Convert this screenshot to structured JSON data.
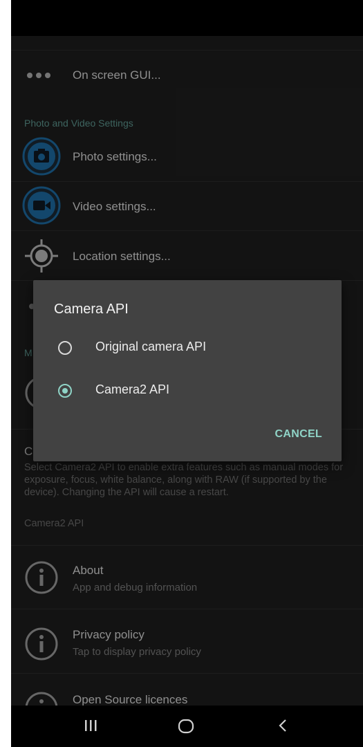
{
  "settings": {
    "on_screen_gui": "On screen GUI...",
    "photo_video_header": "Photo and Video Settings",
    "photo_settings": "Photo settings...",
    "video_settings": "Video settings...",
    "location_settings": "Location settings...",
    "camera_api_partial_title": "C",
    "misc_header_partial": "M",
    "camera_api_desc": "Select Camera2 API to enable extra features such as manual modes for exposure, focus, white balance, along with RAW (if supported by the device). Changing the API will cause a restart.",
    "camera_api_value": "Camera2 API",
    "about_title": "About",
    "about_sub": "App and debug information",
    "privacy_title": "Privacy policy",
    "privacy_sub": "Tap to display privacy policy",
    "licences_title": "Open Source licences"
  },
  "dialog": {
    "title": "Camera API",
    "options": [
      {
        "label": "Original camera API",
        "selected": false
      },
      {
        "label": "Camera2 API",
        "selected": true
      }
    ],
    "cancel_label": "CANCEL"
  },
  "colors": {
    "accent": "#8fd3c6",
    "section_header": "#5f9a93",
    "icon_blue": "#1e6ea7",
    "dialog_bg": "#424242",
    "list_bg": "#1e1e1e"
  },
  "icons": {
    "dots": "more-horiz-icon",
    "photo": "camera-icon",
    "video": "videocam-icon",
    "location": "location-target-icon",
    "info": "info-icon",
    "nav_recents": "recents-icon",
    "nav_home": "home-icon",
    "nav_back": "back-icon"
  }
}
